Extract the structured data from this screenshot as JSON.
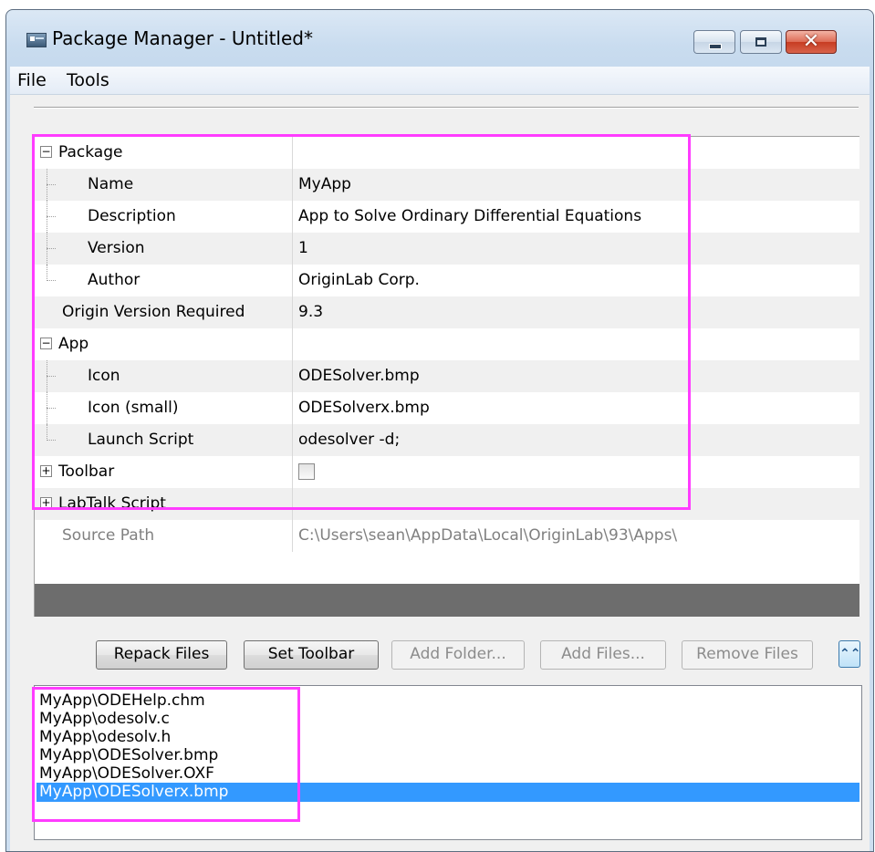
{
  "window": {
    "title": "Package Manager - Untitled*",
    "icon": "app-window-icon",
    "controls": [
      "minimize-icon",
      "maximize-icon",
      "close-icon"
    ],
    "close_glyph": "✕"
  },
  "menu": {
    "file": "File",
    "tools": "Tools"
  },
  "properties": {
    "package": {
      "header": "Package",
      "expander": "−",
      "rows": [
        {
          "name": "Name",
          "value": "MyApp"
        },
        {
          "name": "Description",
          "value": "App to Solve Ordinary Differential Equations"
        },
        {
          "name": "Version",
          "value": "1"
        },
        {
          "name": "Author",
          "value": "OriginLab Corp."
        }
      ]
    },
    "origin_version": {
      "name": "Origin Version Required",
      "value": "9.3"
    },
    "app": {
      "header": "App",
      "expander": "−",
      "rows": [
        {
          "name": "Icon",
          "value": "ODESolver.bmp"
        },
        {
          "name": "Icon (small)",
          "value": "ODESolverx.bmp"
        },
        {
          "name": "Launch Script",
          "value": "odesolver -d;"
        }
      ]
    },
    "toolbar": {
      "header": "Toolbar",
      "expander": "+",
      "checked": false
    },
    "labtalk": {
      "header": "LabTalk Script",
      "expander": "+"
    },
    "source_path": {
      "name": "Source Path",
      "value": "C:\\Users\\sean\\AppData\\Local\\OriginLab\\93\\Apps\\"
    }
  },
  "buttons": {
    "repack": "Repack Files",
    "set_toolbar": "Set Toolbar",
    "add_folder": "Add Folder...",
    "add_files": "Add Files...",
    "remove_files": "Remove Files",
    "collapse_glyph": "⌃⌃"
  },
  "files": [
    "MyApp\\ODEHelp.chm",
    "MyApp\\odesolv.c",
    "MyApp\\odesolv.h",
    "MyApp\\ODESolver.bmp",
    "MyApp\\ODESolver.OXF",
    "MyApp\\ODESolverx.bmp"
  ],
  "selected_file_index": 5,
  "colors": {
    "highlight": "#ff3cff",
    "selection": "#3399ff"
  }
}
